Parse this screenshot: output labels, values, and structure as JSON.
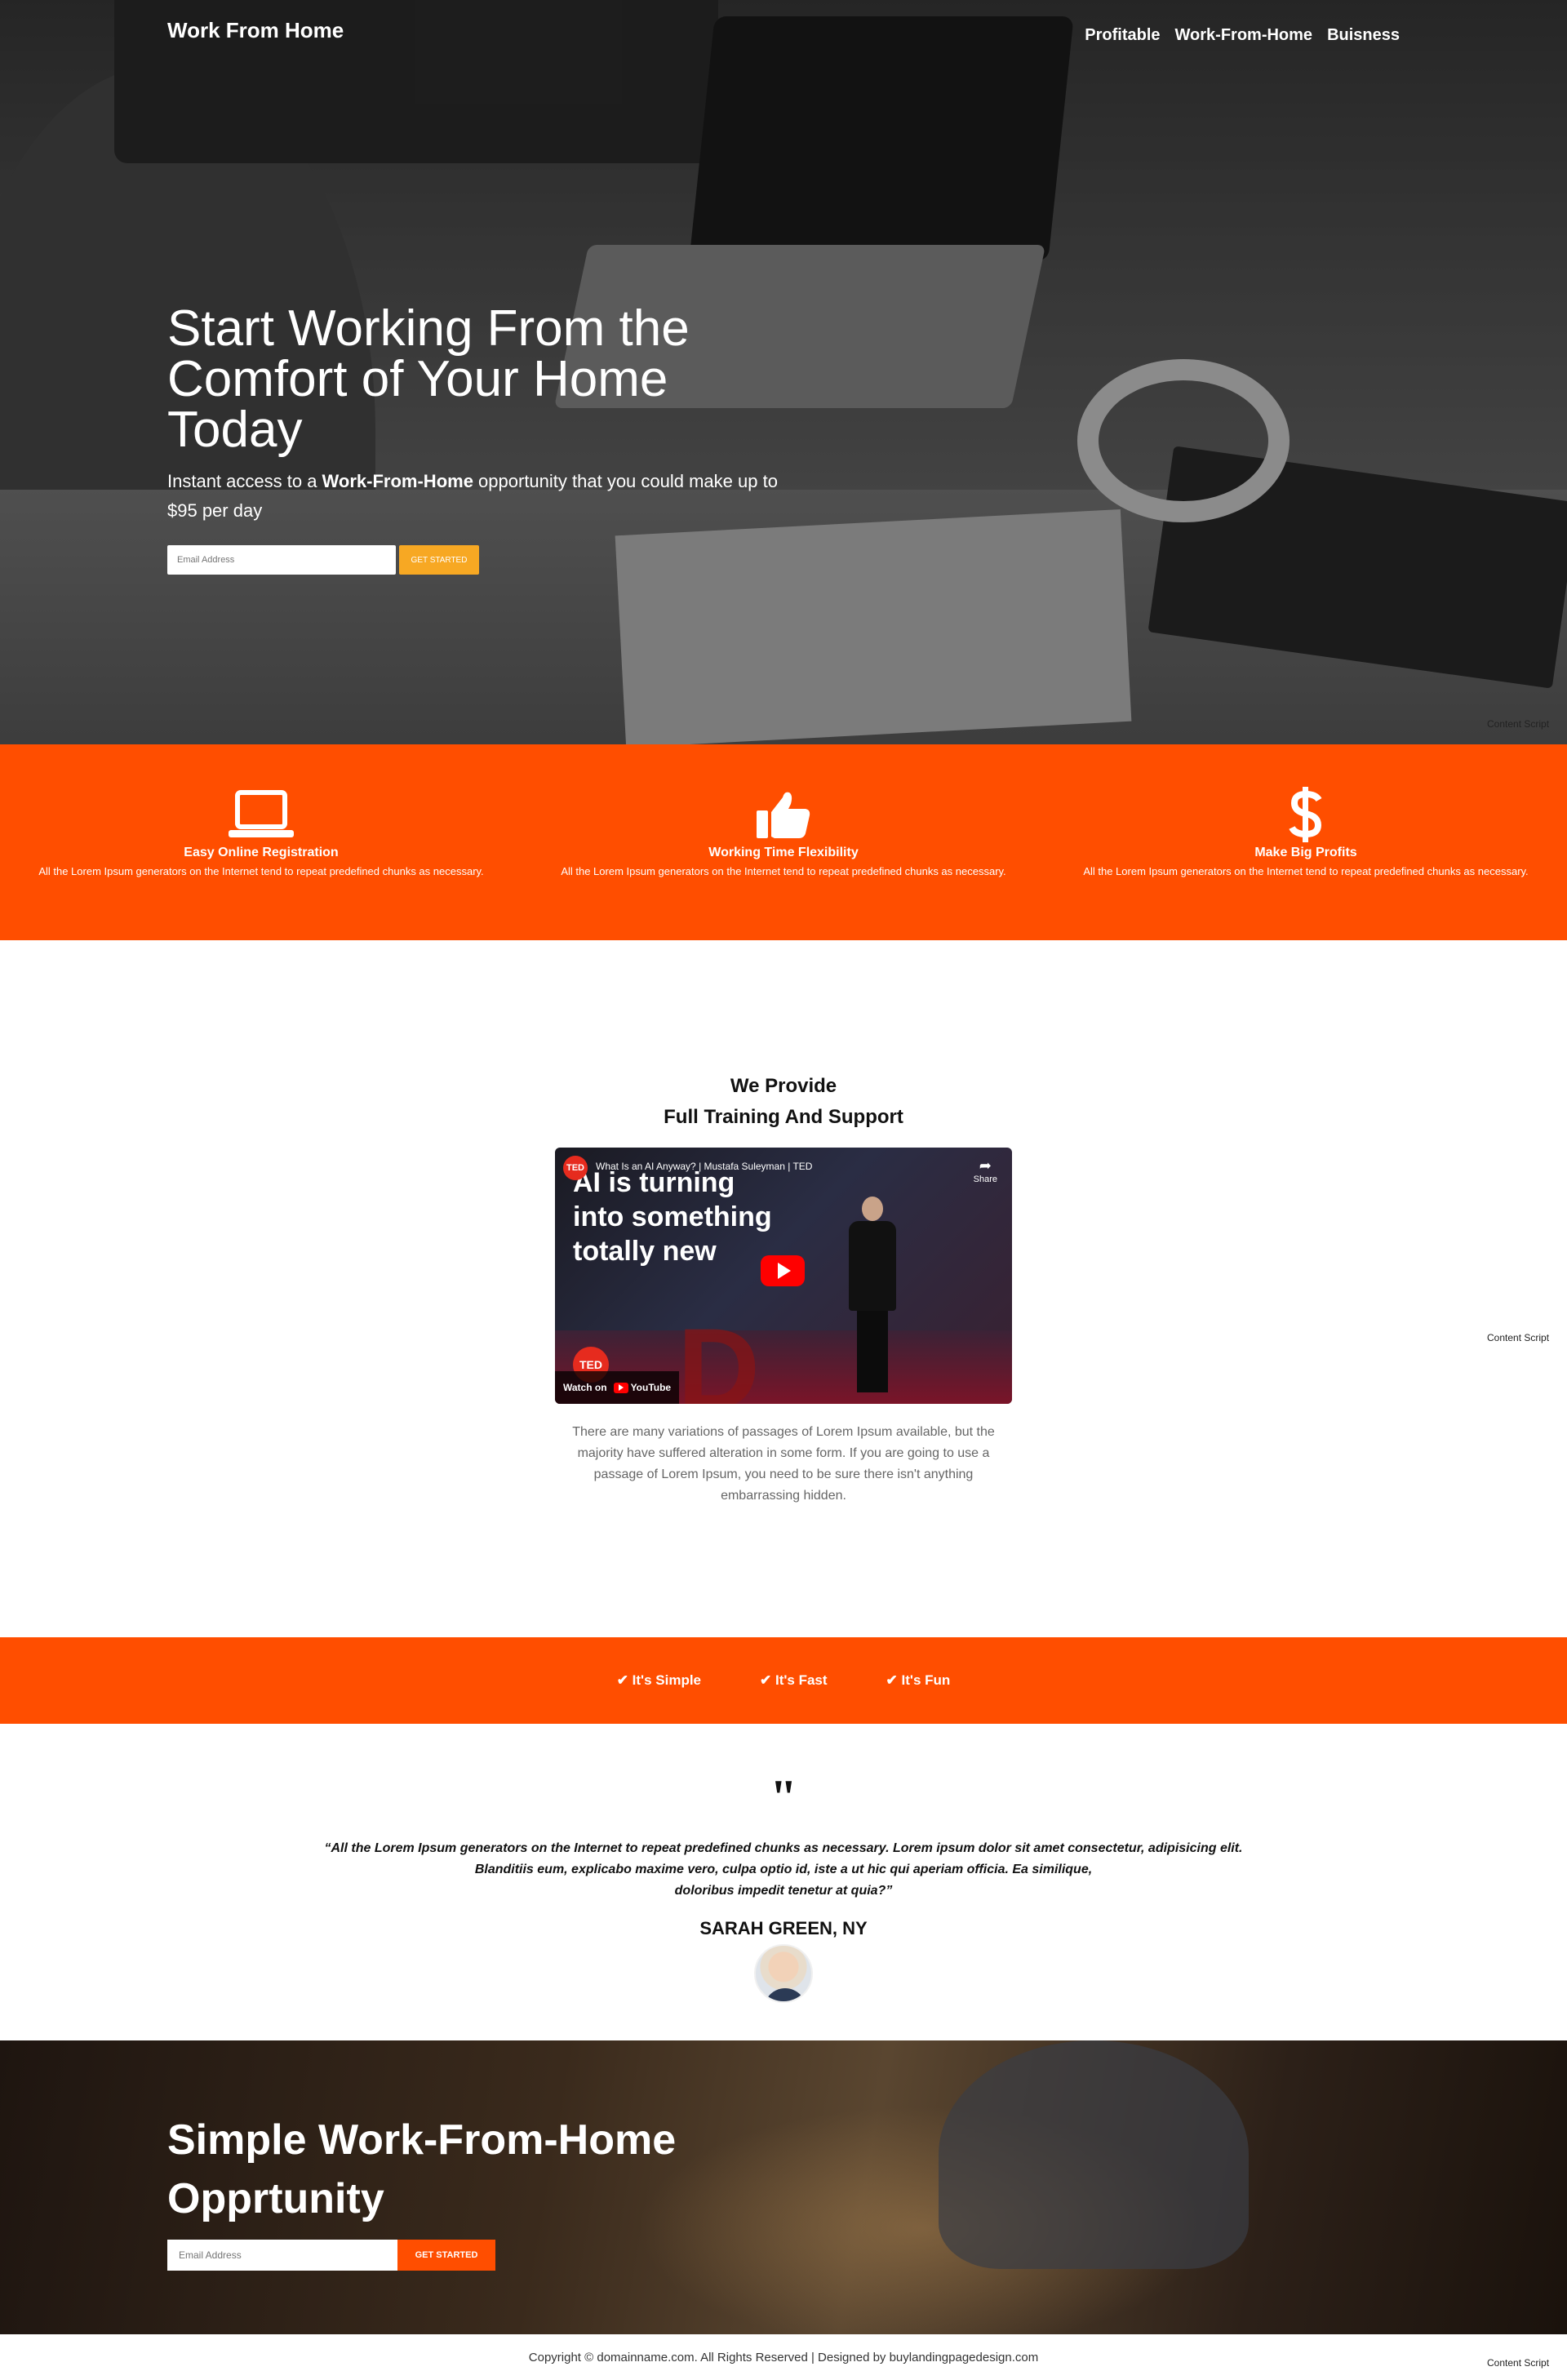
{
  "header": {
    "logo": "Work From Home",
    "nav": [
      "Profitable",
      "Work-From-Home",
      "Buisness"
    ]
  },
  "hero": {
    "title": "Start Working From the Comfort of Your Home Today",
    "subtitle_pre": "Instant access to a ",
    "subtitle_bold": "Work-From-Home",
    "subtitle_post": " opportunity that you could make up to $95 per day",
    "email_placeholder": "Email Address",
    "button": "GET STARTED"
  },
  "content_script_label": "Content Script",
  "features": [
    {
      "icon": "laptop-icon",
      "title": "Easy Online Registration",
      "text": "All the Lorem Ipsum generators on the Internet tend to repeat predefined chunks as necessary."
    },
    {
      "icon": "thumbs-up-icon",
      "title": "Working Time Flexibility",
      "text": "All the Lorem Ipsum generators on the Internet tend to repeat predefined chunks as necessary."
    },
    {
      "icon": "dollar-icon",
      "title": "Make Big Profits",
      "text": "All the Lorem Ipsum generators on the Internet tend to repeat predefined chunks as necessary."
    }
  ],
  "provide": {
    "title_line1": "We Provide",
    "title_line2": "Full Training And Support",
    "video": {
      "title": "What Is an AI Anyway? | Mustafa Suleyman | TED",
      "overlay_line1": "AI is turning",
      "overlay_line2": "into something",
      "overlay_line3": "totally new",
      "share": "Share",
      "watch_on": "Watch on",
      "youtube": "YouTube",
      "ted": "TED"
    },
    "text": "There are many variations of passages of Lorem Ipsum available, but the majority have suffered alteration in some form. If you are going to use a passage of Lorem Ipsum, you need to be sure there isn't anything embarrassing hidden."
  },
  "bar": [
    "✔ It's Simple",
    "✔ It's Fast",
    "✔ It's Fun"
  ],
  "testimonial": {
    "quote_mark": "\"",
    "line1": "“All the Lorem Ipsum generators on the Internet to repeat predefined chunks as necessary. Lorem ipsum dolor sit amet consectetur, adipisicing elit.",
    "line2": "Blanditiis eum, explicabo maxime vero, culpa optio id, iste a ut hic qui aperiam officia. Ea similique,",
    "line3": "doloribus impedit tenetur at quia?”",
    "name": "SARAH GREEN, NY"
  },
  "cta": {
    "title": "Simple Work-From-Home Opprtunity",
    "email_placeholder": "Email Address",
    "button": "GET STARTED"
  },
  "footer": {
    "copyright": "Copyright © domainname.com. All Rights Reserved | Designed by buylandingpagedesign.com"
  },
  "colors": {
    "accent": "#ff4e00",
    "hero_button": "#f7a823"
  }
}
